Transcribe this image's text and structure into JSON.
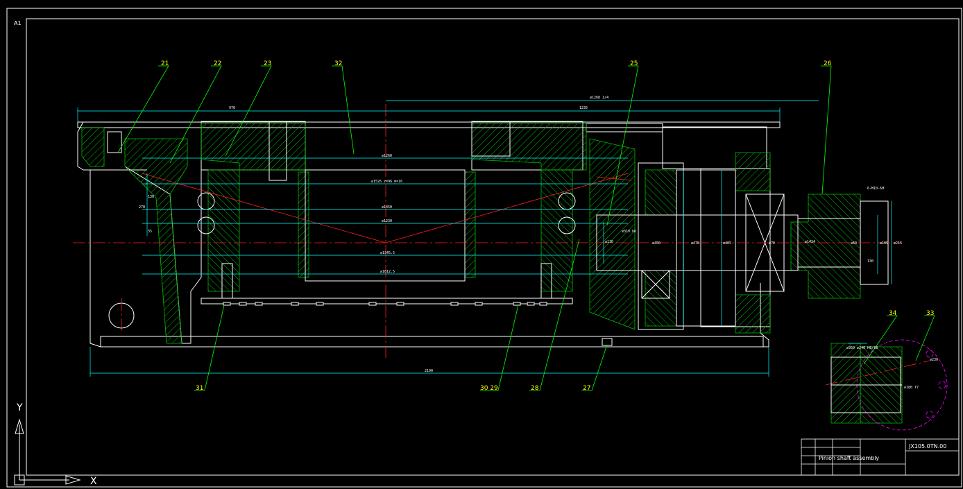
{
  "sheet_size": "A1",
  "part_labels": [
    "21",
    "22",
    "23",
    "32",
    "25",
    "26",
    "31",
    "30 29",
    "28",
    "27",
    "34",
    "33"
  ],
  "dimensions": {
    "top_left": "970",
    "top_right": "1235",
    "top_overall": "∅1268 1/4",
    "bottom_overall": "2190",
    "bore_1": "∅1260",
    "bore_2": "∅1526 z=96 m=16",
    "bore_3": "∅1450",
    "bore_4": "∅1230",
    "bore_5": "∅1345.5",
    "bore_6": "∅1012.5",
    "left_1": "270",
    "left_2": "130",
    "left_3": "35",
    "shaft_1": "∅110",
    "shaft_2": "∅450",
    "shaft_3": "∅478",
    "shaft_4": "∅405",
    "shaft_5": "∅70",
    "shaft_6": "∅310 h6",
    "shaft_7": "∅1424",
    "shaft_8": "∅60",
    "shaft_9": "∅105",
    "shaft_10": "∅215",
    "shaft_11": "130",
    "hole_note": "6-M10-6H",
    "detail_note": "∅360 ∅240 H8/f8",
    "detail_dim_1": "∅230",
    "detail_dim_2": "∅180 f7"
  },
  "title_block": {
    "drawing_no": "JX105.0TN.00",
    "name": "Pinion shaft assembly",
    "cells": [
      "",
      "",
      "",
      ""
    ]
  },
  "ucs": {
    "x_label": "X",
    "y_label": "Y"
  },
  "colors": {
    "background": "#000000",
    "frame": "#ffffff",
    "outline": "#ffffff",
    "hatch": "#00c000",
    "dimension": "#00ffff",
    "centerline": "#ff2020",
    "leader": "#00ff00",
    "label": "#ffff00",
    "detail": "#ff00ff"
  }
}
